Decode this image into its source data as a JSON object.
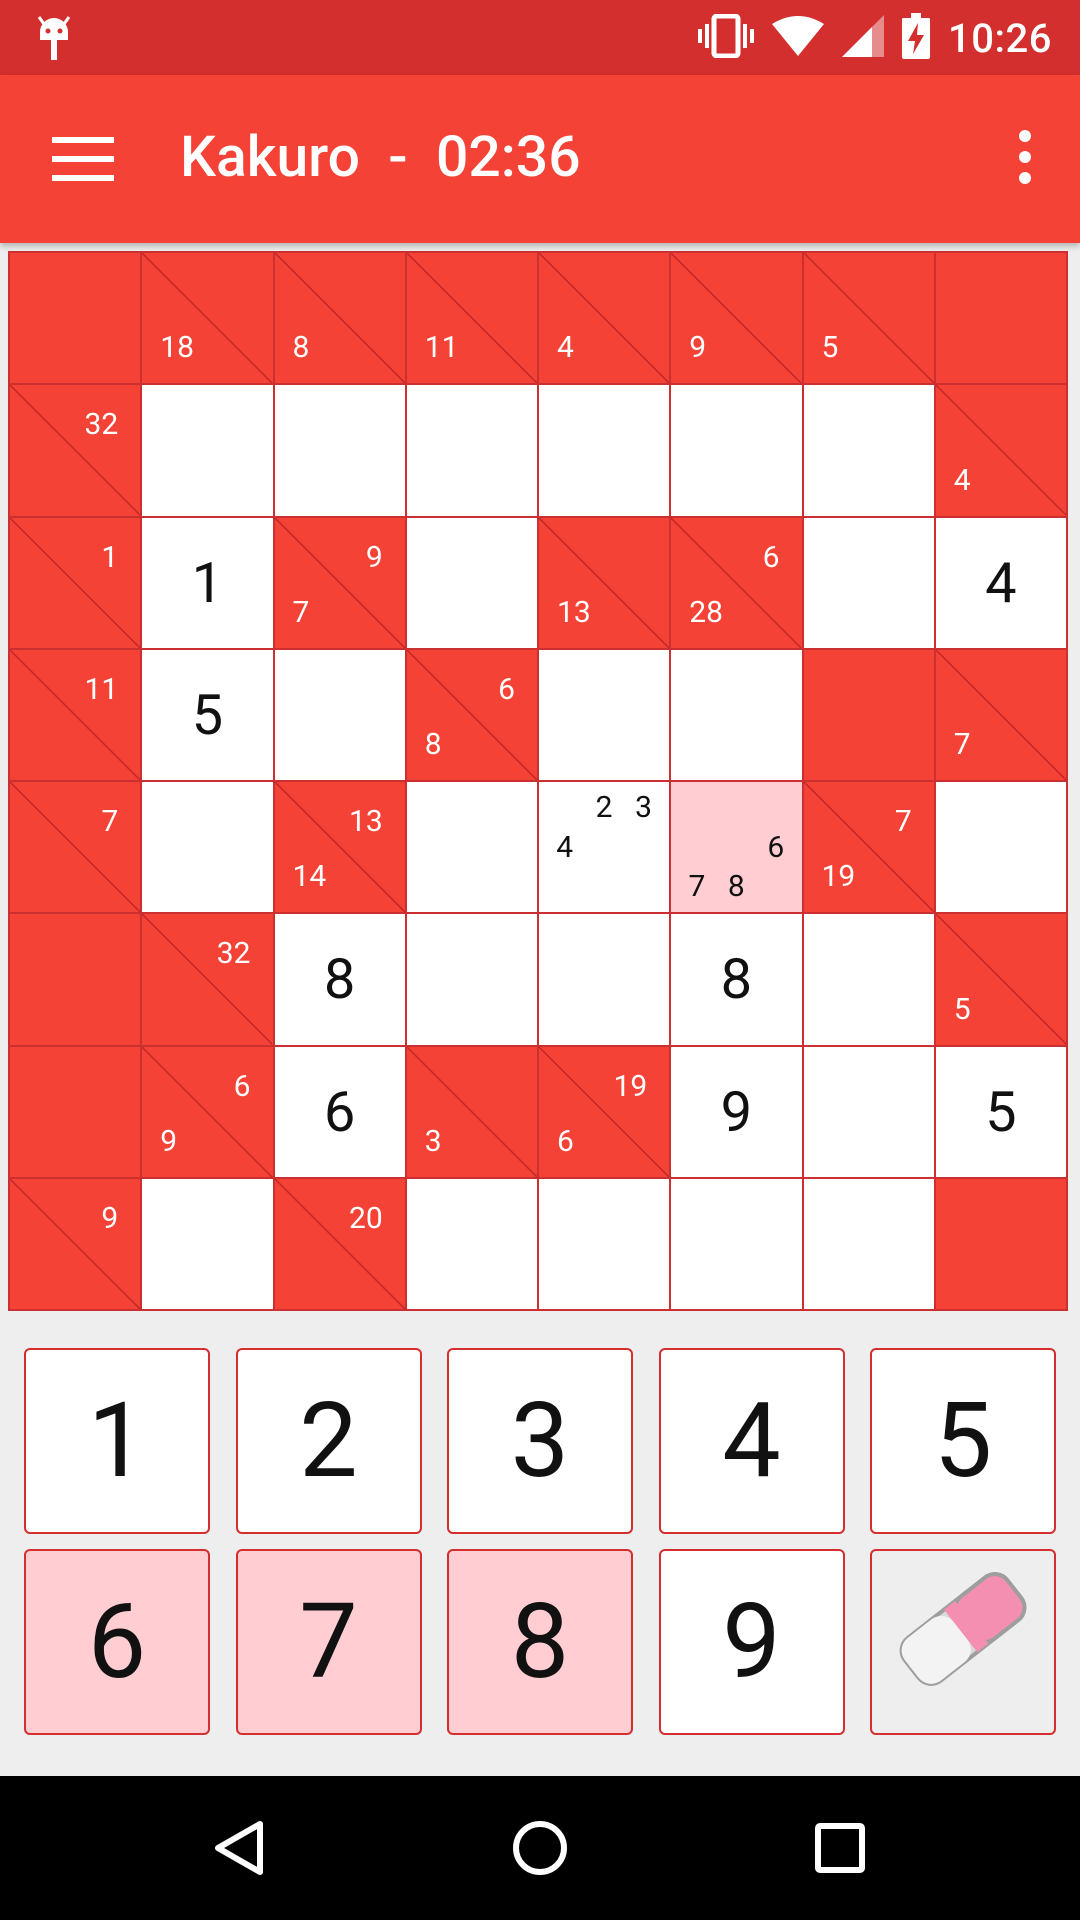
{
  "status_bar": {
    "time": "10:26",
    "icons": [
      "android-debug-icon",
      "vibrate-icon",
      "wifi-icon",
      "cell-signal-icon",
      "battery-charging-icon"
    ]
  },
  "toolbar": {
    "title": "Kakuro  -  02:36",
    "menu_icon": "menu-icon",
    "overflow_icon": "more-vert-icon"
  },
  "colors": {
    "status_bar": "#d32f2f",
    "toolbar": "#f44336",
    "clue_cell": "#f44336",
    "grid_line": "#cc2f2f",
    "selected_cell": "#ffcdd2",
    "background": "#eeeeee"
  },
  "board": {
    "rows": [
      [
        {
          "type": "black"
        },
        {
          "type": "clue",
          "down": "18"
        },
        {
          "type": "clue",
          "down": "8"
        },
        {
          "type": "clue",
          "down": "11"
        },
        {
          "type": "clue",
          "down": "4"
        },
        {
          "type": "clue",
          "down": "9"
        },
        {
          "type": "clue",
          "down": "5"
        },
        {
          "type": "black"
        }
      ],
      [
        {
          "type": "clue",
          "across": "32"
        },
        {
          "type": "white"
        },
        {
          "type": "white"
        },
        {
          "type": "white"
        },
        {
          "type": "white"
        },
        {
          "type": "white"
        },
        {
          "type": "white"
        },
        {
          "type": "clue",
          "down": "4"
        }
      ],
      [
        {
          "type": "clue",
          "across": "1"
        },
        {
          "type": "white",
          "value": "1"
        },
        {
          "type": "clue",
          "across": "9",
          "down": "7"
        },
        {
          "type": "white"
        },
        {
          "type": "clue",
          "down": "13"
        },
        {
          "type": "clue",
          "across": "6",
          "down": "28"
        },
        {
          "type": "white"
        },
        {
          "type": "white",
          "value": "4"
        }
      ],
      [
        {
          "type": "clue",
          "across": "11"
        },
        {
          "type": "white",
          "value": "5"
        },
        {
          "type": "white"
        },
        {
          "type": "clue",
          "across": "6",
          "down": "8"
        },
        {
          "type": "white"
        },
        {
          "type": "white"
        },
        {
          "type": "black"
        },
        {
          "type": "clue",
          "down": "7"
        }
      ],
      [
        {
          "type": "clue",
          "across": "7"
        },
        {
          "type": "white"
        },
        {
          "type": "clue",
          "across": "13",
          "down": "14"
        },
        {
          "type": "white"
        },
        {
          "type": "white",
          "notes": [
            "",
            "2",
            "3",
            "4",
            "",
            "",
            "",
            "",
            ""
          ]
        },
        {
          "type": "white",
          "selected": true,
          "notes": [
            "",
            "",
            "",
            "",
            "",
            "6",
            "7",
            "8",
            ""
          ]
        },
        {
          "type": "clue",
          "across": "7",
          "down": "19"
        },
        {
          "type": "white"
        }
      ],
      [
        {
          "type": "black"
        },
        {
          "type": "clue",
          "across": "32"
        },
        {
          "type": "white",
          "value": "8"
        },
        {
          "type": "white"
        },
        {
          "type": "white"
        },
        {
          "type": "white",
          "value": "8"
        },
        {
          "type": "white"
        },
        {
          "type": "clue",
          "down": "5"
        }
      ],
      [
        {
          "type": "black"
        },
        {
          "type": "clue",
          "across": "6",
          "down": "9"
        },
        {
          "type": "white",
          "value": "6"
        },
        {
          "type": "clue",
          "down": "3"
        },
        {
          "type": "clue",
          "across": "19",
          "down": "6"
        },
        {
          "type": "white",
          "value": "9"
        },
        {
          "type": "white"
        },
        {
          "type": "white",
          "value": "5"
        }
      ],
      [
        {
          "type": "clue",
          "across": "9"
        },
        {
          "type": "white"
        },
        {
          "type": "clue",
          "across": "20"
        },
        {
          "type": "white"
        },
        {
          "type": "white"
        },
        {
          "type": "white"
        },
        {
          "type": "white"
        },
        {
          "type": "black"
        }
      ]
    ]
  },
  "keypad": {
    "keys": [
      {
        "label": "1",
        "highlighted": false
      },
      {
        "label": "2",
        "highlighted": false
      },
      {
        "label": "3",
        "highlighted": false
      },
      {
        "label": "4",
        "highlighted": false
      },
      {
        "label": "5",
        "highlighted": false
      },
      {
        "label": "6",
        "highlighted": true
      },
      {
        "label": "7",
        "highlighted": true
      },
      {
        "label": "8",
        "highlighted": true
      },
      {
        "label": "9",
        "highlighted": false
      }
    ],
    "eraser_icon": "eraser-icon"
  },
  "nav_bar": {
    "icons": [
      "back-icon",
      "home-icon",
      "recents-icon"
    ]
  }
}
